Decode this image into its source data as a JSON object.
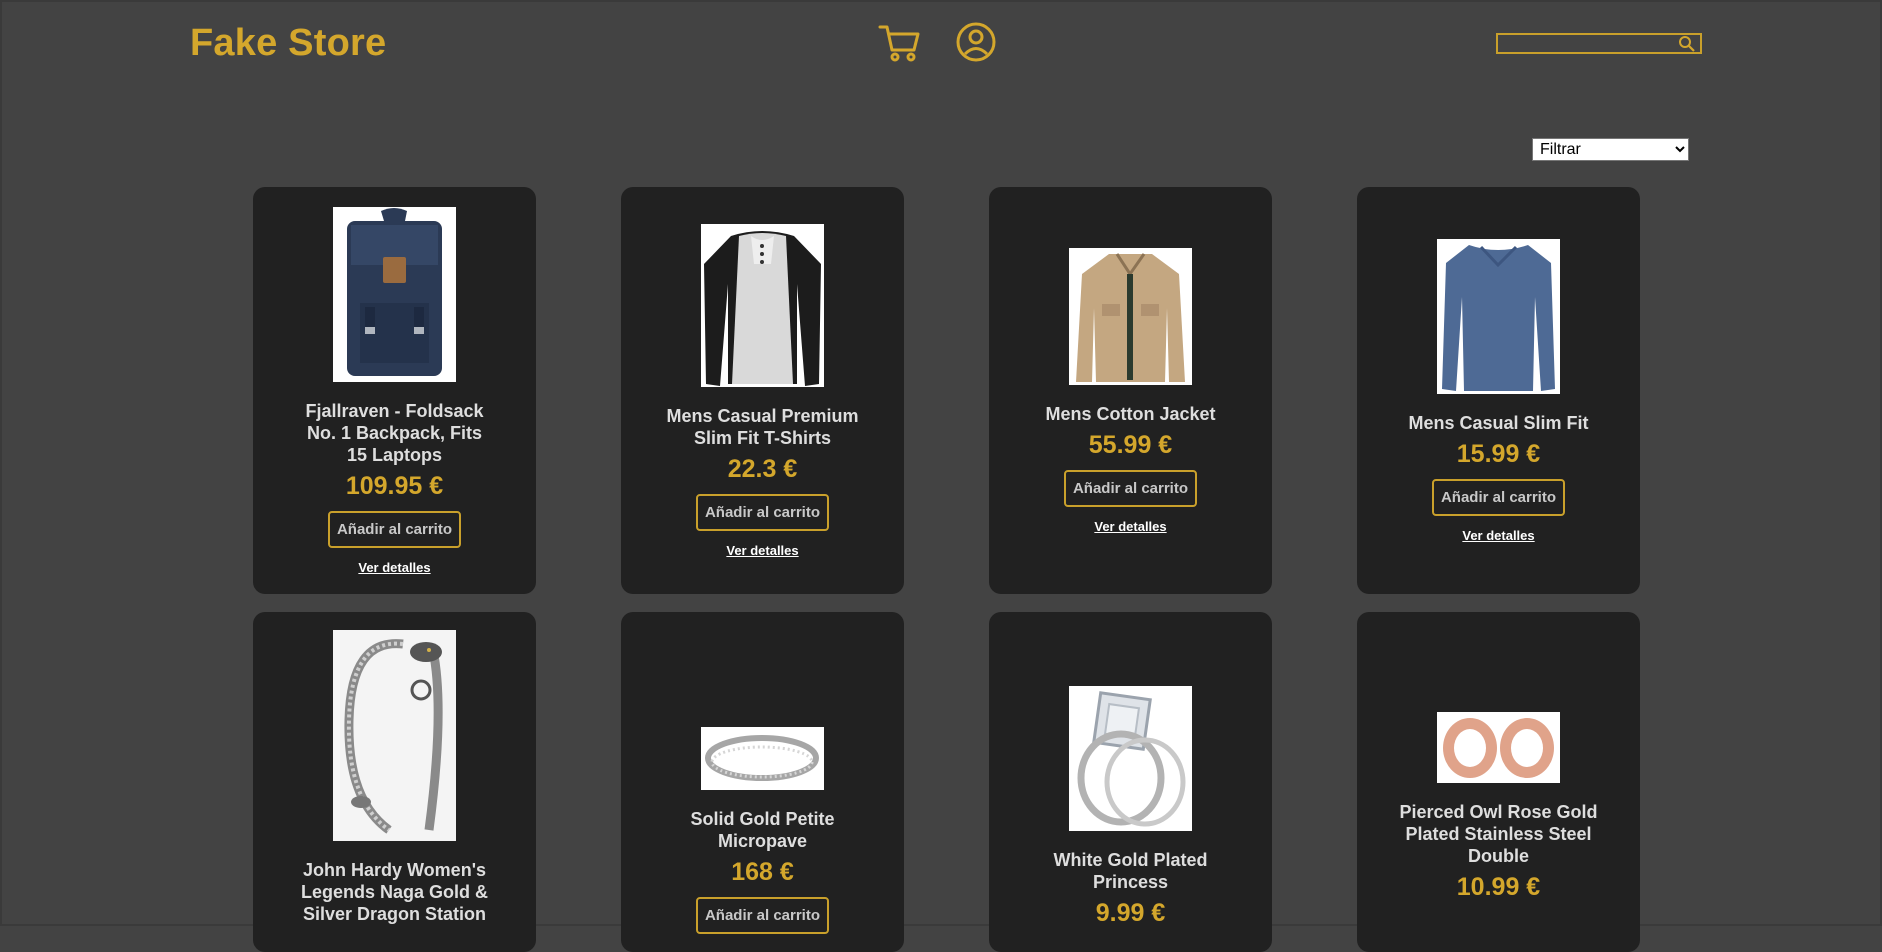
{
  "header": {
    "logo": "Fake Store",
    "cart_icon": "cart-icon",
    "user_icon": "user-circle-icon",
    "search_placeholder": "",
    "search_icon": "search-icon"
  },
  "filter": {
    "selected": "Filtrar"
  },
  "colors": {
    "accent": "#d4a72c",
    "background": "#434343",
    "card": "#212121"
  },
  "products": [
    {
      "name": "Fjallraven - Foldsack No. 1 Backpack, Fits 15 Laptops",
      "price": "109.95 €",
      "add_label": "Añadir al carrito",
      "details_label": "Ver detalles"
    },
    {
      "name": "Mens Casual Premium Slim Fit T-Shirts",
      "price": "22.3 €",
      "add_label": "Añadir al carrito",
      "details_label": "Ver detalles"
    },
    {
      "name": "Mens Cotton Jacket",
      "price": "55.99 €",
      "add_label": "Añadir al carrito",
      "details_label": "Ver detalles"
    },
    {
      "name": "Mens Casual Slim Fit",
      "price": "15.99 €",
      "add_label": "Añadir al carrito",
      "details_label": "Ver detalles"
    },
    {
      "name": "John Hardy Women's Legends Naga Gold & Silver Dragon Station",
      "price": "",
      "add_label": "",
      "details_label": ""
    },
    {
      "name": "Solid Gold Petite Micropave",
      "price": "168 €",
      "add_label": "Añadir al carrito",
      "details_label": ""
    },
    {
      "name": "White Gold Plated Princess",
      "price": "9.99 €",
      "add_label": "",
      "details_label": ""
    },
    {
      "name": "Pierced Owl Rose Gold Plated Stainless Steel Double",
      "price": "10.99 €",
      "add_label": "",
      "details_label": ""
    }
  ]
}
